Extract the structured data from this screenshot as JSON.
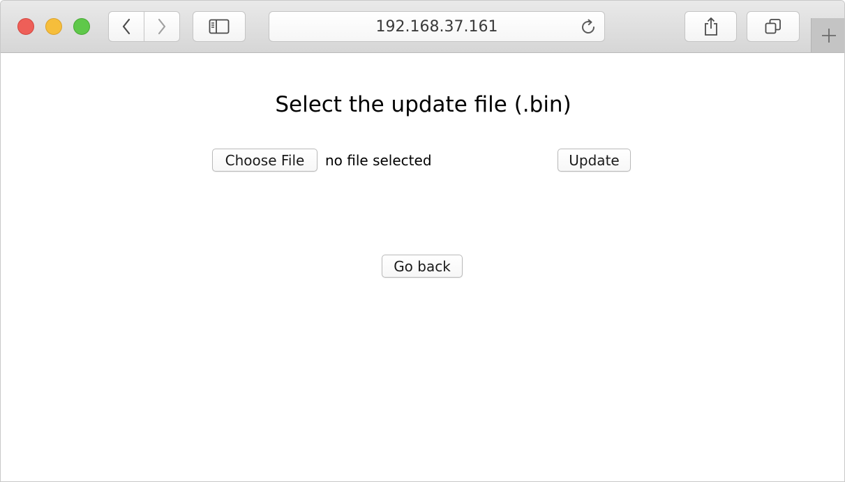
{
  "browser": {
    "address": "192.168.37.161",
    "icons": {
      "back": "chevron-left-icon",
      "forward": "chevron-right-icon",
      "sidebar": "sidebar-icon",
      "reload": "reload-icon",
      "share": "share-icon",
      "tabs": "tabs-overview-icon",
      "new_tab": "plus-icon"
    },
    "colors": {
      "close": "#ee5f58",
      "minimize": "#f6be3b",
      "maximize": "#5fc84a"
    }
  },
  "page": {
    "title": "Select the update file (.bin)",
    "choose_file_label": "Choose File",
    "file_status": "no file selected",
    "update_label": "Update",
    "go_back_label": "Go back"
  }
}
